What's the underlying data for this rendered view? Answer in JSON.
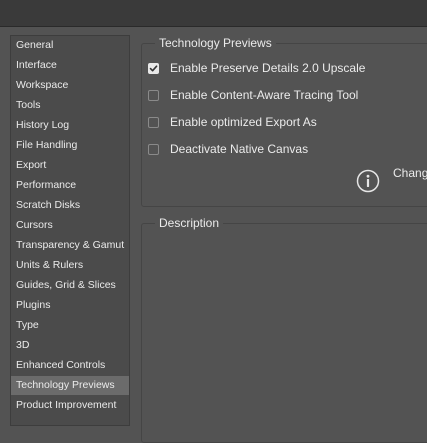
{
  "sidebar": {
    "items": [
      {
        "label": "General"
      },
      {
        "label": "Interface"
      },
      {
        "label": "Workspace"
      },
      {
        "label": "Tools"
      },
      {
        "label": "History Log"
      },
      {
        "label": "File Handling"
      },
      {
        "label": "Export"
      },
      {
        "label": "Performance"
      },
      {
        "label": "Scratch Disks"
      },
      {
        "label": "Cursors"
      },
      {
        "label": "Transparency & Gamut"
      },
      {
        "label": "Units & Rulers"
      },
      {
        "label": "Guides, Grid & Slices"
      },
      {
        "label": "Plugins"
      },
      {
        "label": "Type"
      },
      {
        "label": "3D"
      },
      {
        "label": "Enhanced Controls"
      },
      {
        "label": "Technology Previews",
        "selected": true
      },
      {
        "label": "Product Improvement"
      }
    ]
  },
  "tech_previews": {
    "title": "Technology Previews",
    "options": [
      {
        "label": "Enable Preserve Details 2.0 Upscale",
        "checked": true
      },
      {
        "label": "Enable Content-Aware Tracing Tool",
        "checked": false
      },
      {
        "label": "Enable optimized Export As",
        "checked": false
      },
      {
        "label": "Deactivate Native Canvas",
        "checked": false
      }
    ],
    "info_text": "Chang",
    "info_icon": "info-circle-icon"
  },
  "description": {
    "title": "Description"
  },
  "colors": {
    "background": "#535353",
    "sidebar_background": "#4b4b4b",
    "selected_item": "#6b6b6b",
    "titlebar": "#3a3a3a"
  }
}
